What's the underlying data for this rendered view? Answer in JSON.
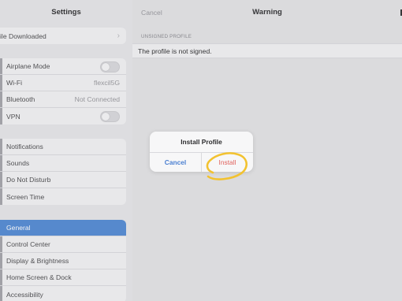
{
  "sidebar": {
    "title": "Settings",
    "downloaded": {
      "label": "ile Downloaded"
    },
    "connectivity": [
      {
        "label": "Airplane Mode",
        "toggle": "off"
      },
      {
        "label": "Wi-Fi",
        "value": "flexcil5G"
      },
      {
        "label": "Bluetooth",
        "value": "Not Connected"
      },
      {
        "label": "VPN",
        "toggle": "off"
      }
    ],
    "notifications": [
      {
        "label": "Notifications"
      },
      {
        "label": "Sounds"
      },
      {
        "label": "Do Not Disturb"
      },
      {
        "label": "Screen Time"
      }
    ],
    "general": [
      {
        "label": "General",
        "selected": true
      },
      {
        "label": "Control Center"
      },
      {
        "label": "Display & Brightness"
      },
      {
        "label": "Home Screen & Dock"
      },
      {
        "label": "Accessibility"
      }
    ]
  },
  "main": {
    "nav": {
      "cancel": "Cancel",
      "title": "Warning"
    },
    "section_header": "UNSIGNED PROFILE",
    "info_text": "The profile is not signed."
  },
  "alert": {
    "title": "Install Profile",
    "cancel": "Cancel",
    "install": "Install"
  },
  "colors": {
    "accent_blue": "#4a7fd1",
    "selected_bg": "#5a8fd6",
    "destructive_red": "#e0625d",
    "annotation_yellow": "#f2c230"
  }
}
